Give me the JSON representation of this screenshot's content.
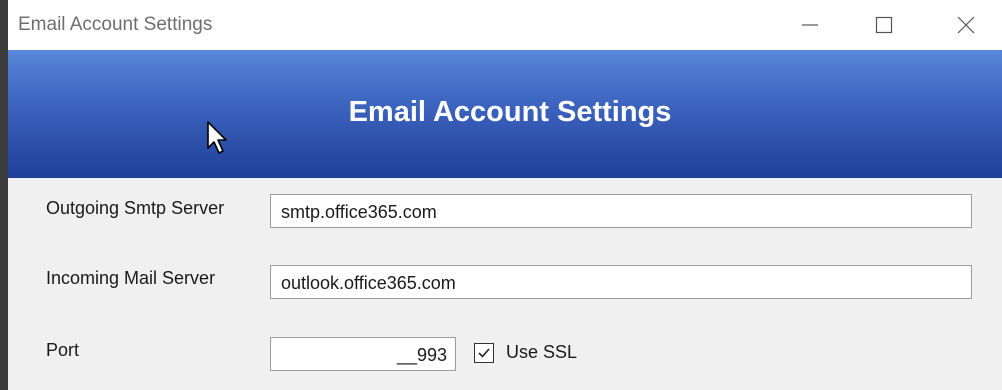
{
  "window": {
    "title": "Email Account Settings",
    "controls": [
      "minimize-icon",
      "maximize-icon",
      "close-icon"
    ]
  },
  "banner": {
    "heading": "Email Account Settings",
    "background_color": "#2f56b0"
  },
  "form": {
    "smtp": {
      "label": "Outgoing Smtp Server",
      "value": "smtp.office365.com"
    },
    "incoming": {
      "label": "Incoming Mail Server",
      "value": "outlook.office365.com"
    },
    "port": {
      "label": "Port",
      "value": "__993"
    },
    "ssl": {
      "label": "Use SSL",
      "checked": true
    }
  }
}
